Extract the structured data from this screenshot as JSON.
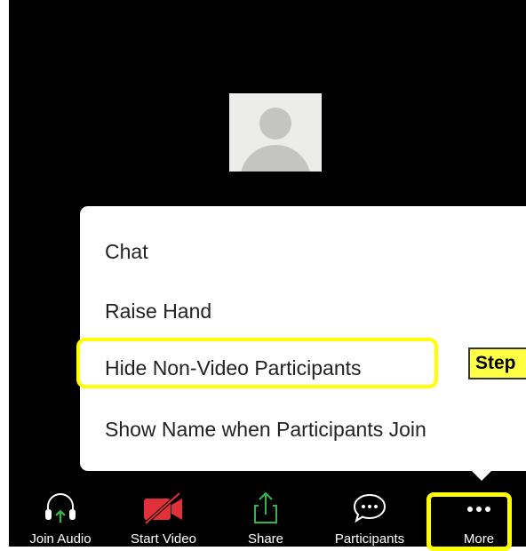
{
  "menu": {
    "items": [
      {
        "label": "Chat"
      },
      {
        "label": "Raise Hand"
      },
      {
        "label": "Hide Non-Video Participants"
      },
      {
        "label": "Show Name when Participants Join"
      }
    ]
  },
  "annotation": {
    "step_label": "Step"
  },
  "toolbar": {
    "join_audio": "Join Audio",
    "start_video": "Start Video",
    "share": "Share",
    "participants": "Participants",
    "more": "More"
  },
  "colors": {
    "highlight": "#ffff00",
    "video_off_red": "#e0303a",
    "share_green": "#2db84d",
    "background": "#000000"
  },
  "icons": [
    "headphones-icon",
    "video-off-icon",
    "share-icon",
    "participants-chat-icon",
    "more-dots-icon",
    "avatar-placeholder-icon"
  ]
}
